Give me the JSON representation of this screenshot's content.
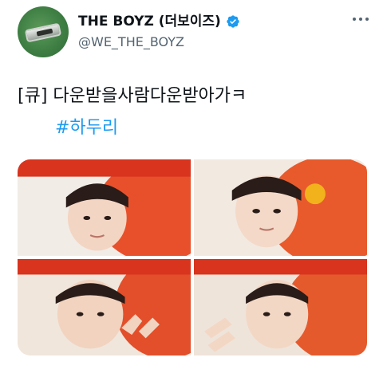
{
  "tweet": {
    "author": {
      "display_name": "THE BOYZ (더보이즈)",
      "handle": "@WE_THE_BOYZ",
      "verified": true,
      "avatar_icon": "ring-logo-avatar"
    },
    "text": "[큐] 다운받을사람다운받아가ㅋ",
    "hashtag": "#하두리",
    "media_count": 4
  },
  "colors": {
    "link": "#1d9bf0",
    "verified_badge": "#1d9bf0",
    "secondary_text": "#536471"
  }
}
